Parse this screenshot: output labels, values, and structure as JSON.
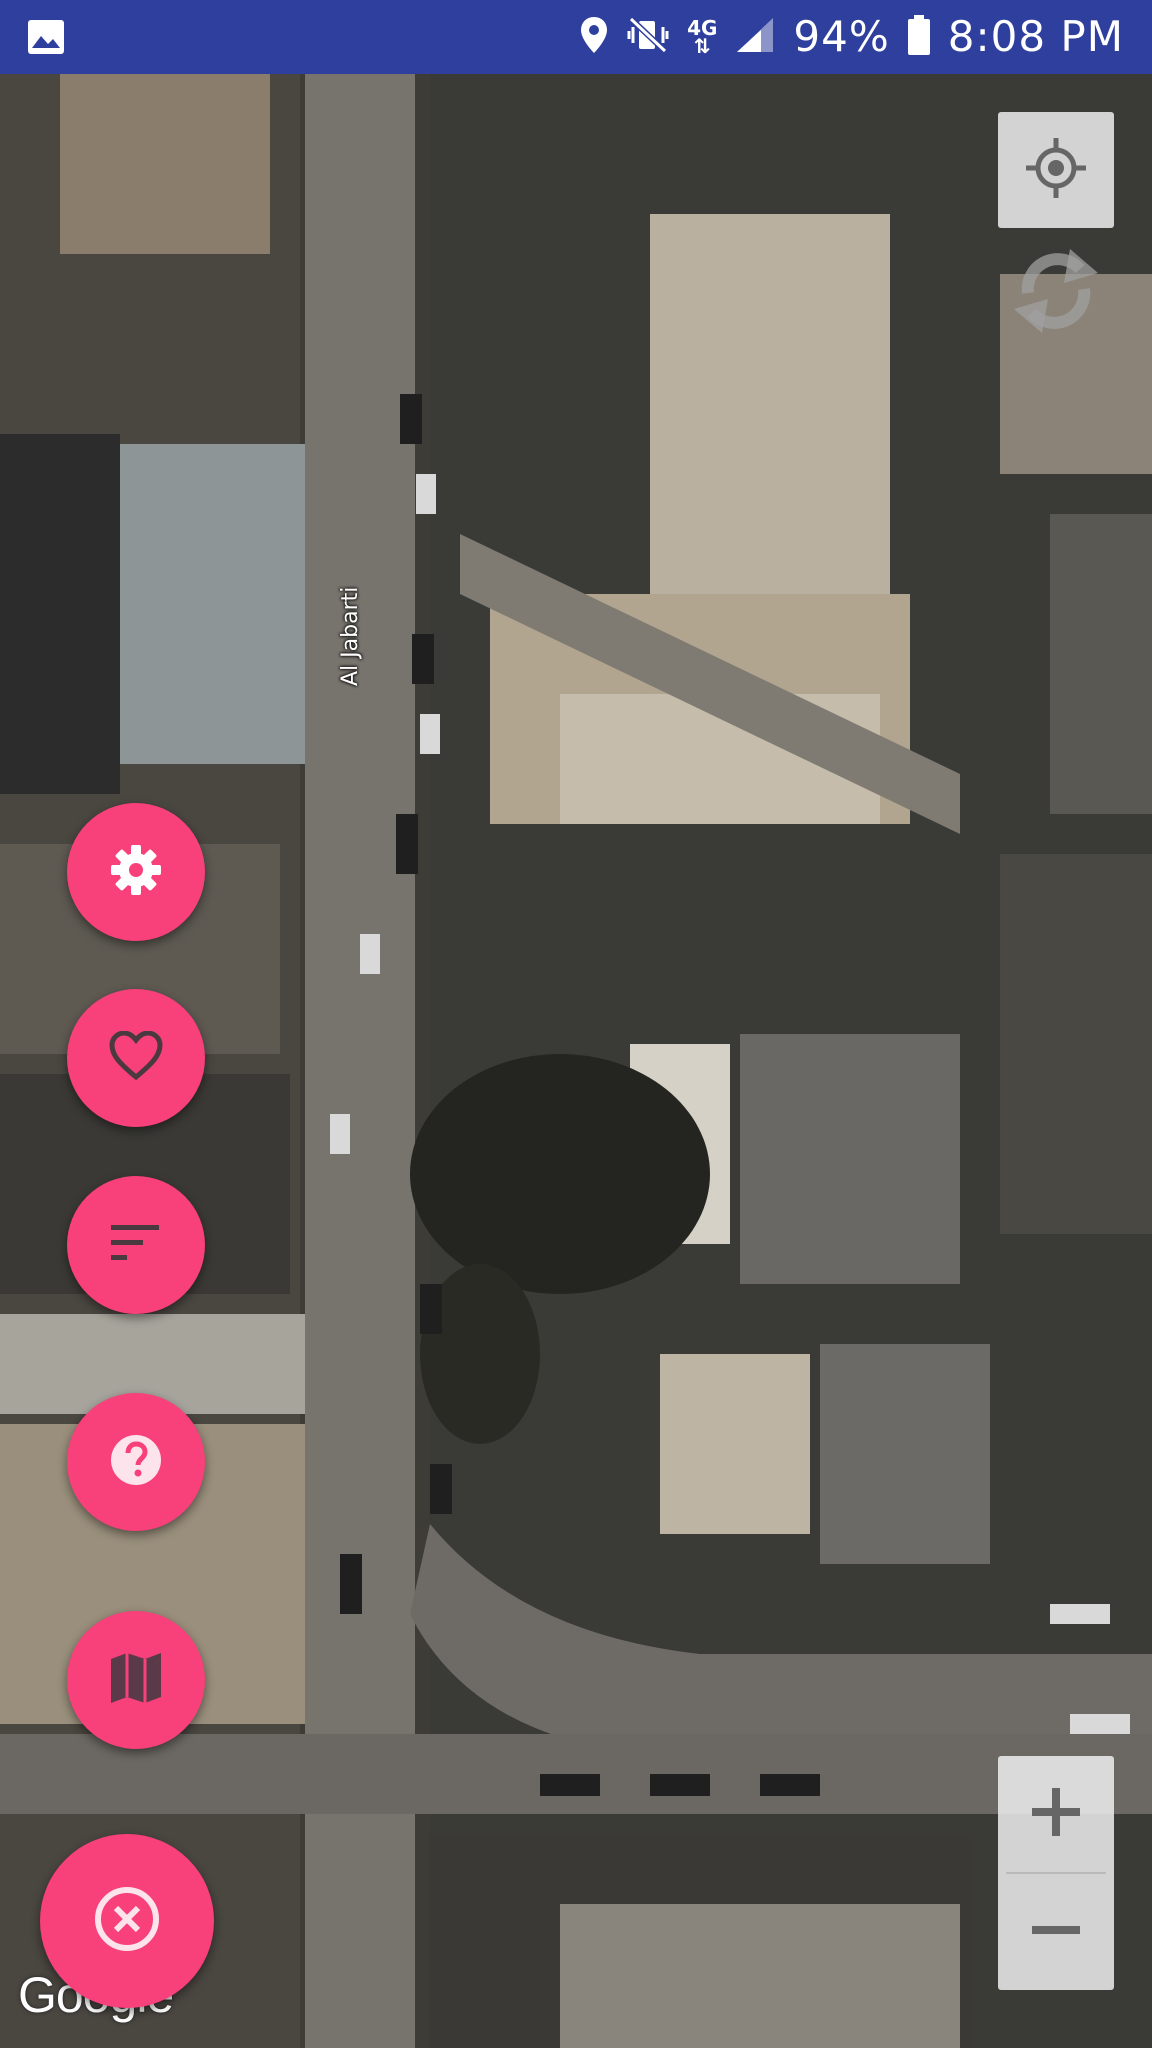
{
  "status_bar": {
    "gallery_icon": "image-icon",
    "location_icon": "location-pin-icon",
    "mute_icon": "vibrate-mute-icon",
    "network_type": "4G",
    "signal_icon": "signal-icon",
    "battery_percent": "94%",
    "battery_icon": "battery-icon",
    "time": "8:08 PM"
  },
  "map": {
    "street_label": "Al Jabarti",
    "logo": "Google"
  },
  "controls": {
    "locate_icon": "my-location-icon",
    "refresh_icon": "refresh-icon",
    "zoom_in_icon": "plus-icon",
    "zoom_out_icon": "minus-icon"
  },
  "fab_menu": {
    "accent_color": "#f8407b",
    "items": [
      {
        "name": "settings",
        "icon": "gear-icon"
      },
      {
        "name": "favorites",
        "icon": "heart-icon"
      },
      {
        "name": "sort",
        "icon": "sort-icon"
      },
      {
        "name": "help",
        "icon": "help-icon"
      },
      {
        "name": "map-type",
        "icon": "map-icon"
      },
      {
        "name": "close",
        "icon": "close-circle-icon"
      }
    ]
  }
}
